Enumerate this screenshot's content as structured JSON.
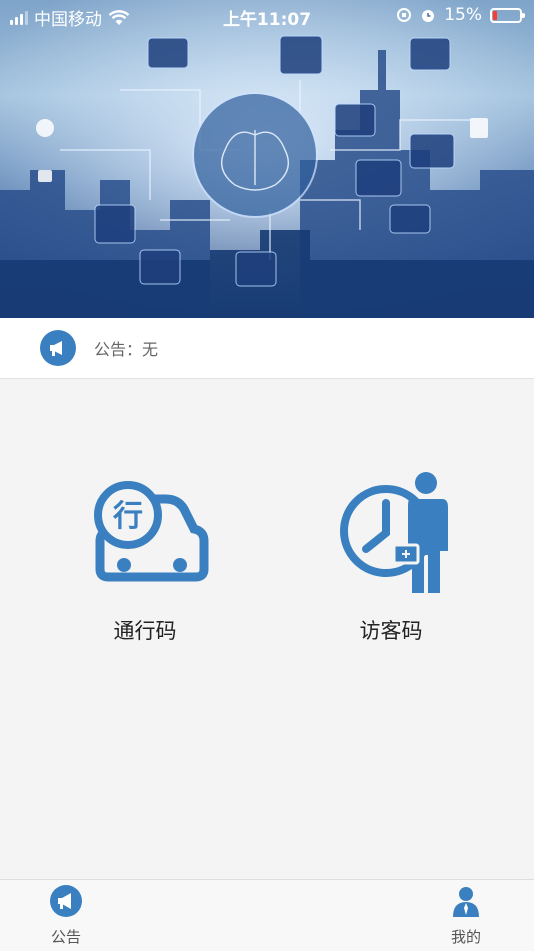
{
  "status_bar": {
    "carrier": "中国移动",
    "time": "上午11:07",
    "battery": "15%",
    "battery_level": 0.15
  },
  "notice": {
    "label": "公告：无",
    "icon": "megaphone-icon"
  },
  "features": [
    {
      "label": "通行码",
      "icon": "car-pass-icon",
      "icon_text": "行"
    },
    {
      "label": "访客码",
      "icon": "visitor-clock-icon"
    }
  ],
  "tabbar": {
    "items": [
      {
        "label": "公告",
        "icon": "megaphone-icon"
      },
      {
        "label": "我的",
        "icon": "user-icon"
      }
    ]
  },
  "colors": {
    "accent": "#3a80c1",
    "background": "#f4f4f4"
  }
}
